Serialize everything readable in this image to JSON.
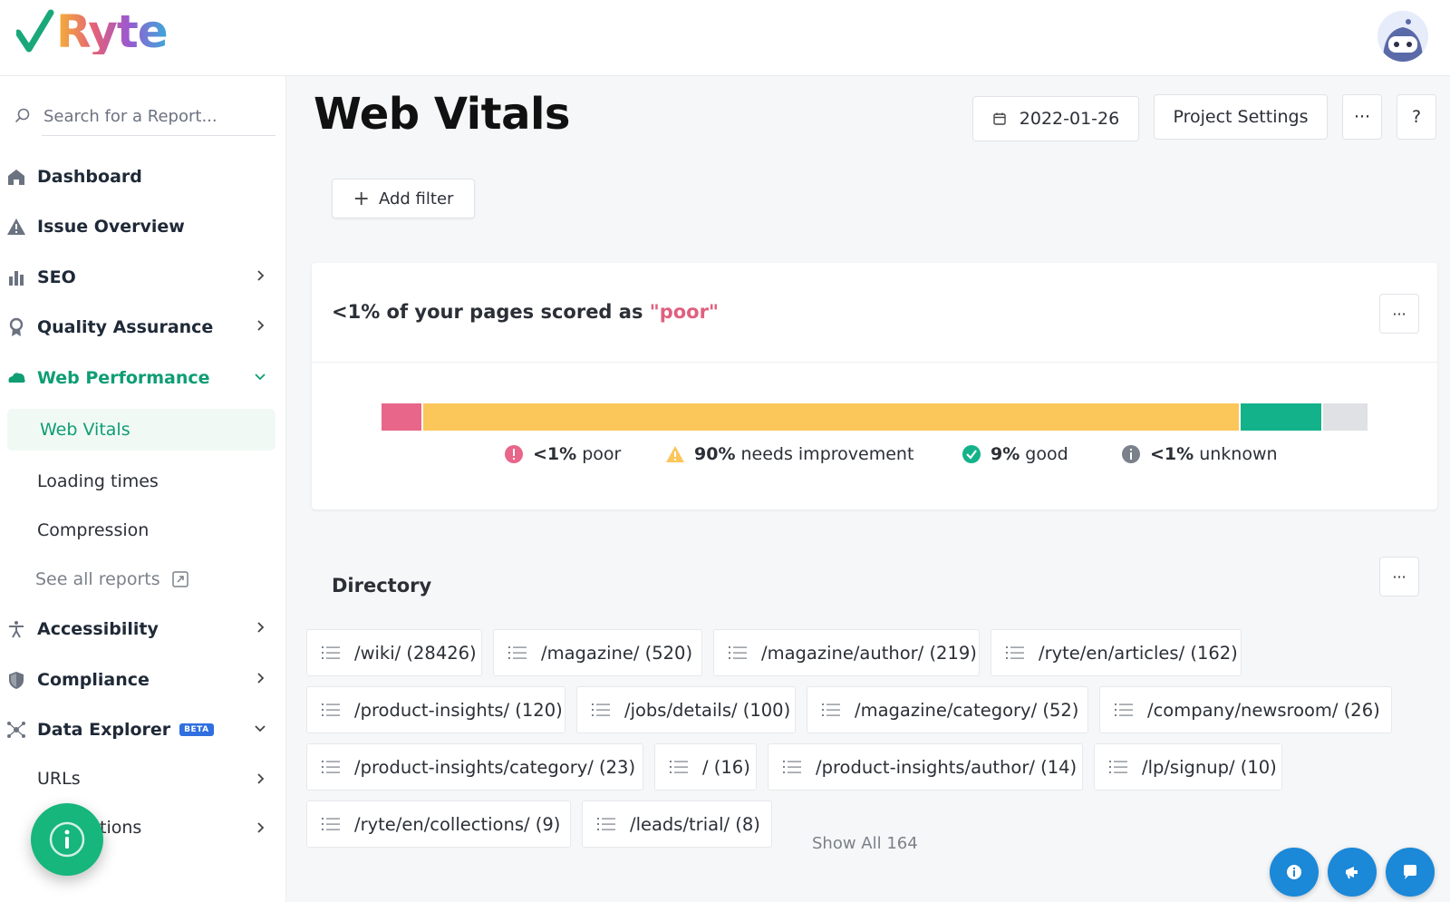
{
  "app": {
    "logo_text": "Ryte"
  },
  "sidebar": {
    "search_placeholder": "Search for a Report...",
    "items": [
      {
        "label": "Dashboard"
      },
      {
        "label": "Issue Overview"
      },
      {
        "label": "SEO"
      },
      {
        "label": "Quality Assurance"
      },
      {
        "label": "Web Performance"
      },
      {
        "label": "Accessibility"
      },
      {
        "label": "Compliance"
      },
      {
        "label": "Data Explorer",
        "badge": "BETA"
      }
    ],
    "web_performance_sub": [
      {
        "label": "Web Vitals"
      },
      {
        "label": "Loading times"
      },
      {
        "label": "Compression"
      },
      {
        "label": "See all reports"
      }
    ],
    "data_explorer_sub": [
      {
        "label": "URLs"
      },
      {
        "label": "tions"
      }
    ],
    "accent_color": "#0f9d74"
  },
  "header": {
    "title": "Web Vitals",
    "date": "2022-01-26",
    "settings_label": "Project Settings",
    "more_label": "···",
    "help_label": "?"
  },
  "filter": {
    "add_label": "Add filter"
  },
  "score_card": {
    "title_prefix": "<1% of your pages scored as ",
    "title_highlight": "\"poor\"",
    "more_label": "···",
    "segments": [
      {
        "name": "poor",
        "fraction": 0.042,
        "color": "#e8668a"
      },
      {
        "name": "needs improvement",
        "fraction": 0.829,
        "color": "#fbc65a"
      },
      {
        "name": "good",
        "fraction": 0.084,
        "color": "#14b28b"
      },
      {
        "name": "unknown",
        "fraction": 0.045,
        "color": "#dfe1e4"
      }
    ],
    "legend": [
      {
        "pct": "<1%",
        "label": "poor",
        "icon": "exclamation-icon",
        "color": "#e8668a"
      },
      {
        "pct": "90%",
        "label": "needs improvement",
        "icon": "warning-icon",
        "color": "#fbc65a"
      },
      {
        "pct": "9%",
        "label": "good",
        "icon": "check-circle-icon",
        "color": "#14b28b"
      },
      {
        "pct": "<1%",
        "label": "unknown",
        "icon": "info-icon",
        "color": "#7b818a"
      }
    ]
  },
  "directory": {
    "title": "Directory",
    "more_label": "···",
    "chips": [
      "/wiki/ (28426)",
      "/magazine/ (520)",
      "/magazine/author/ (219)",
      "/ryte/en/articles/ (162)",
      "/product-insights/ (120)",
      "/jobs/details/ (100)",
      "/magazine/category/ (52)",
      "/company/newsroom/ (26)",
      "/product-insights/category/ (23)",
      "/ (16)",
      "/product-insights/author/ (14)",
      "/lp/signup/ (10)",
      "/ryte/en/collections/ (9)",
      "/leads/trial/ (8)"
    ],
    "show_all": "Show All 164"
  }
}
